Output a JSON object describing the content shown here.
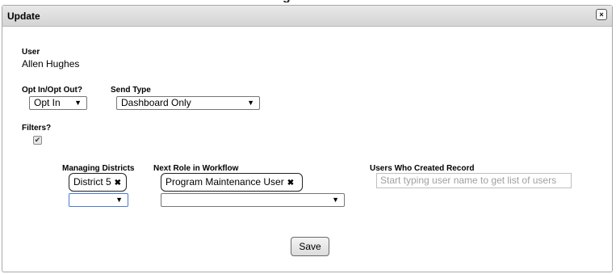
{
  "page_peek_text": "g",
  "dialog": {
    "title": "Update",
    "close_label": "×"
  },
  "user": {
    "label": "User",
    "value": "Allen Hughes"
  },
  "opt": {
    "label": "Opt In/Opt Out?",
    "selected": "Opt In"
  },
  "send_type": {
    "label": "Send Type",
    "selected": "Dashboard Only"
  },
  "filters": {
    "label": "Filters?",
    "checked": true,
    "check_glyph": "✔"
  },
  "managing_districts": {
    "label": "Managing Districts",
    "chips": [
      "District 5"
    ],
    "remove_glyph": "✖"
  },
  "next_role": {
    "label": "Next Role in Workflow",
    "chips": [
      "Program Maintenance User"
    ],
    "remove_glyph": "✖"
  },
  "users_created": {
    "label": "Users Who Created Record",
    "placeholder": "Start typing user name to get list of users"
  },
  "dropdown_arrow": "▼",
  "save_label": "Save"
}
